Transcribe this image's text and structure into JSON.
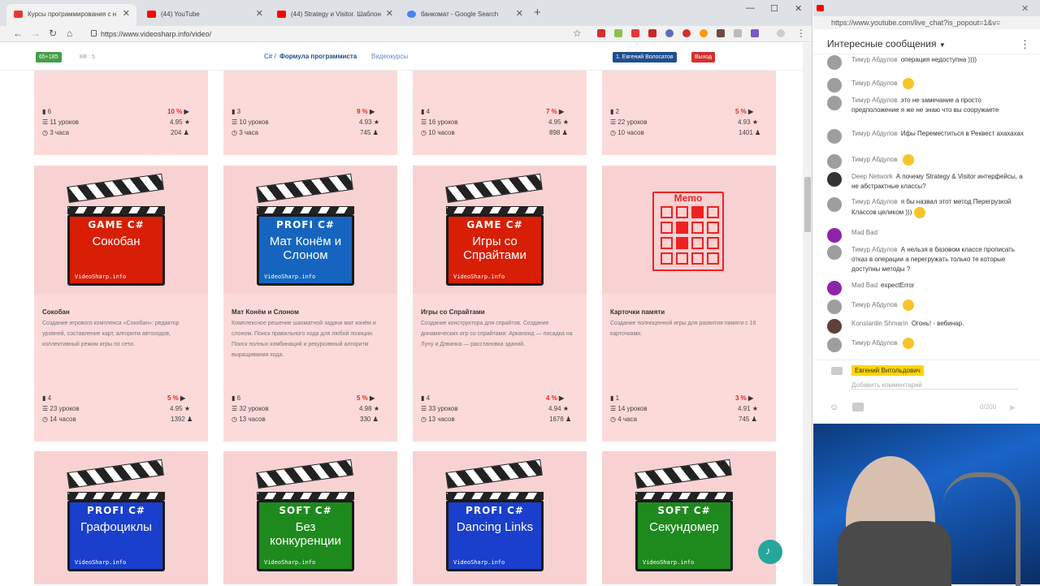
{
  "browser": {
    "tabs": [
      {
        "title": "Курсы программирования с н",
        "active": true,
        "color": "#e53935"
      },
      {
        "title": "(44) YouTube",
        "active": false,
        "color": "#ff0000"
      },
      {
        "title": "(44) Strategy и Visitor. Шаблон",
        "active": false,
        "color": "#ff0000"
      },
      {
        "title": "банкомат - Google Search",
        "active": false,
        "color": "#4285f4"
      }
    ],
    "url": "https://www.videosharp.info/video/"
  },
  "site": {
    "badge_left": "65+185",
    "badge_kf": "КФ : 5",
    "brand_prefix": "C# /",
    "brand_name": "Формула программиста",
    "nav_link": "Видеокурсы",
    "user_button": "1. Евгений Волосатов",
    "logout_button": "Выход"
  },
  "top_row": [
    {
      "level": "6",
      "pct": "10 %",
      "lessons": "11 уроков",
      "rating": "4.95",
      "hours": "3 часа",
      "students": "204"
    },
    {
      "level": "3",
      "pct": "9 %",
      "lessons": "10 уроков",
      "rating": "4.93",
      "hours": "3 часа",
      "students": "745"
    },
    {
      "level": "4",
      "pct": "7 %",
      "lessons": "16 уроков",
      "rating": "4.95",
      "hours": "10 часов",
      "students": "898"
    },
    {
      "level": "2",
      "pct": "5 %",
      "lessons": "22 уроков",
      "rating": "4.93",
      "hours": "10 часов",
      "students": "1401"
    }
  ],
  "mid_row": [
    {
      "kind": "GAME C#",
      "name": "Сокобан",
      "color": "#d81e05",
      "title": "Сокобан",
      "desc": "Создание игрового комплекса «Сокобан»: редактор уровней, составление карт, алгоритм автоходов, коллективный режим игры по сети.",
      "level": "4",
      "pct": "5 %",
      "lessons": "23 уроков",
      "rating": "4.95",
      "hours": "14 часов",
      "students": "1392"
    },
    {
      "kind": "PROFI C#",
      "name": "Мат Конём и Слоном",
      "color": "#1565c0",
      "title": "Мат Конём и Слоном",
      "desc": "Комплексное решение шахматной задачи мат конём и слоном. Поиск правильного хода для любой позиции. Поиск полных комбинаций и рекурсивный алгоритм выращивания хода.",
      "level": "6",
      "pct": "5 %",
      "lessons": "32 уроков",
      "rating": "4.98",
      "hours": "13 часов",
      "students": "330"
    },
    {
      "kind": "GAME C#",
      "name": "Игры со Спрайтами",
      "color": "#d81e05",
      "title": "Игры со Спрайтами",
      "desc": "Создание конструктора для спрайтов. Создание динамических игр со спрайтами: Арканоид — посадка на Луну и Дэвинка — расстановка зданий.",
      "level": "4",
      "pct": "4 %",
      "lessons": "33 уроков",
      "rating": "4.94",
      "hours": "13 часов",
      "students": "1678"
    },
    {
      "memo": true,
      "title": "Карточки памяти",
      "desc": "Создание полноценной игры для развития памяти с 16 карточками.",
      "memo_label": "Memo",
      "level": "1",
      "pct": "3 %",
      "lessons": "14 уроков",
      "rating": "4.91",
      "hours": "4 часа",
      "students": "745"
    }
  ],
  "bottom_row": [
    {
      "kind": "PROFI C#",
      "name": "Графоциклы",
      "color": "#1a3fcc"
    },
    {
      "kind": "SOFT C#",
      "name": "Без конкуренции",
      "color": "#1e8a1e"
    },
    {
      "kind": "PROFI C#",
      "name": "Dancing Links",
      "color": "#1a3fcc"
    },
    {
      "kind": "SOFT C#",
      "name": "Секундомер",
      "color": "#1e8a1e"
    }
  ],
  "clap_footer": "VideoSharp.info",
  "chat": {
    "url": "https://www.youtube.com/live_chat?is_popout=1&v=",
    "header": "Интересные сообщения",
    "messages": [
      {
        "author": "Тимур Абдулов",
        "text": "операция недоступна ))))",
        "emoji": false
      },
      {
        "author": "Тимур Абдулов",
        "text": "",
        "emoji": true
      },
      {
        "author": "Тимур Абдулов",
        "text": "это не замечание а просто предположение я же не знаю что вы сооружаете",
        "emoji": false
      },
      {
        "author": "Тимур Абдулов",
        "text": "Ифы Переместиться в Реквест ахахахах",
        "emoji": false
      },
      {
        "author": "Тимур Абдулов",
        "text": "",
        "emoji": true
      },
      {
        "author": "Deep Network",
        "text": "А почему Strategy & Visitor интерфейсы, а не абстрактные классы?",
        "emoji": false
      },
      {
        "author": "Тимур Абдулов",
        "text": "я бы назвал этот метод Перегрузкой Классов целиком )))",
        "emoji": true
      },
      {
        "author": "Mad Bad",
        "text": "",
        "emoji": false
      },
      {
        "author": "Тимур Абдулов",
        "text": "А нельзя в базовом классе прописать отказ в операции а перегружать только те которые доступны методы ?",
        "emoji": false
      },
      {
        "author": "Mad Bad",
        "text": "expectError",
        "emoji": false
      },
      {
        "author": "Тимур Абдулов",
        "text": "",
        "emoji": true
      },
      {
        "author": "Konstantin Shmarin",
        "text": "Огонь! - вебинар.",
        "emoji": false
      },
      {
        "author": "Тимур Абдулов",
        "text": "",
        "emoji": true
      }
    ],
    "me_name": "Евгений Витольдович",
    "comment_placeholder": "Добавить комментарий",
    "counter": "0/200"
  }
}
